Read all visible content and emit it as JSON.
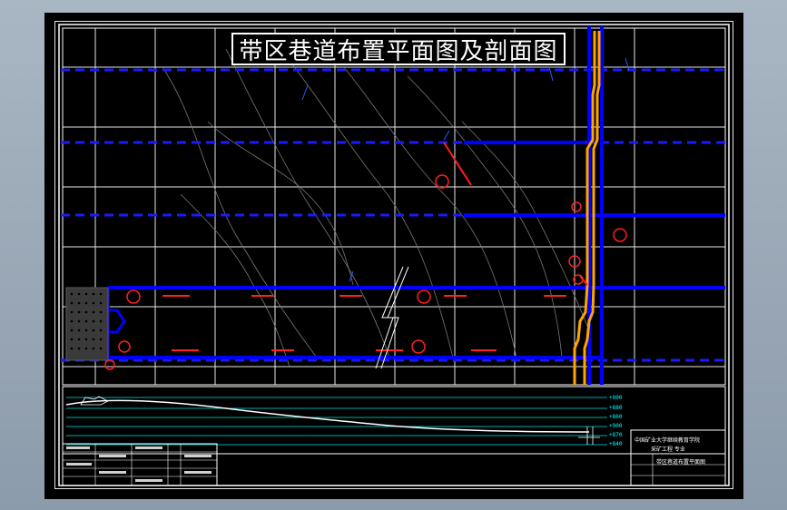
{
  "drawing": {
    "title": "带区巷道布置平面图及剖面图",
    "section_elevations": [
      "+900",
      "+880",
      "+860",
      "+900",
      "+870",
      "+840"
    ]
  },
  "title_block": {
    "institution": "中国矿业大学继续教育学院",
    "major": "采矿工程 专业",
    "drawing_name": "带区巷道布置平面图"
  },
  "colors": {
    "background": "#000000",
    "roadway": "#0000ff",
    "shaft_line": "#ffa500",
    "annotation": "#ff0000",
    "grid": "#ffffff",
    "contour": "#808080",
    "section_lines": "#00ffff",
    "desktop": "#9aa8b6"
  }
}
